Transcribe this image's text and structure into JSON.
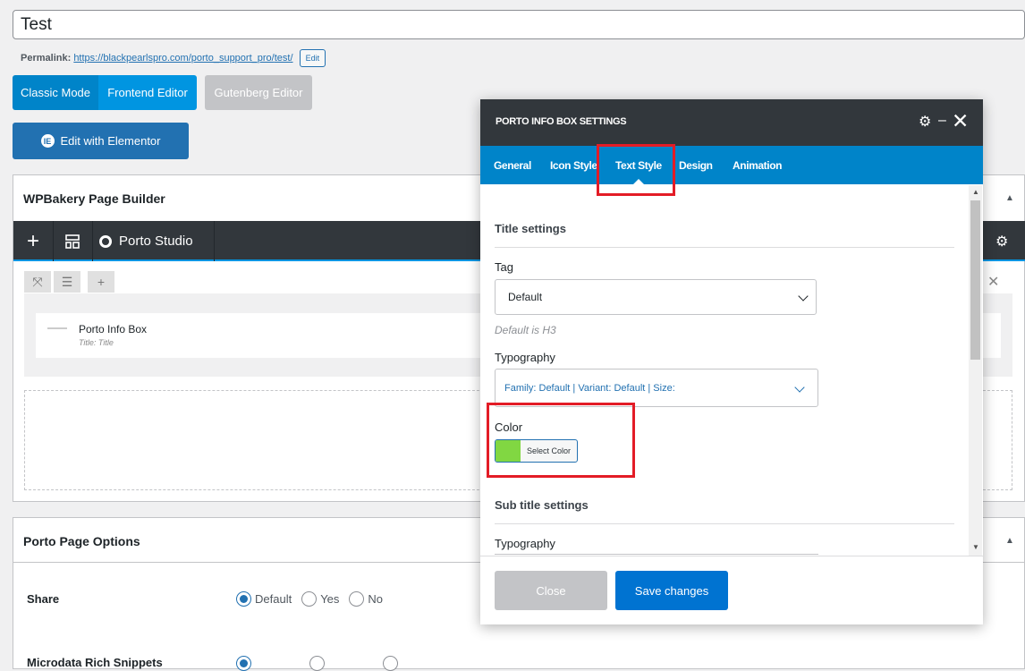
{
  "post": {
    "title": "Test",
    "permalink_label": "Permalink:",
    "permalink_base": "https://blackpearlspro.com/porto_support_pro/",
    "permalink_slug": "test",
    "permalink_edit": "Edit"
  },
  "editor_buttons": {
    "classic": "Classic Mode",
    "frontend": "Frontend Editor",
    "gutenberg": "Gutenberg Editor",
    "elementor": "Edit with Elementor"
  },
  "wpbakery": {
    "title": "WPBakery Page Builder",
    "toolbar": {
      "studio": "Porto Studio"
    },
    "element": {
      "name": "Porto Info Box",
      "sub": "Title: Title"
    }
  },
  "page_options": {
    "title": "Porto Page Options",
    "share": {
      "label": "Share",
      "options": [
        "Default",
        "Yes",
        "No"
      ],
      "selected": "Default"
    },
    "microdata": {
      "label": "Microdata Rich Snippets"
    }
  },
  "modal": {
    "title": "PORTO INFO BOX SETTINGS",
    "tabs": [
      "General",
      "Icon Style",
      "Text Style",
      "Design",
      "Animation"
    ],
    "active_tab": "Text Style",
    "title_settings": {
      "heading": "Title settings",
      "tag_label": "Tag",
      "tag_value": "Default",
      "tag_hint": "Default is H3",
      "typography_label": "Typography",
      "typography_value": "Family: Default | Variant: Default | Size:",
      "color_label": "Color",
      "color_button": "Select Color",
      "color_value": "#81d742"
    },
    "subtitle_settings": {
      "heading": "Sub title settings",
      "typography_label": "Typography"
    },
    "footer": {
      "close": "Close",
      "save": "Save changes"
    }
  },
  "colors": {
    "accent": "#0084c9",
    "highlight": "#e31c26",
    "dark_bar": "#32373c"
  }
}
